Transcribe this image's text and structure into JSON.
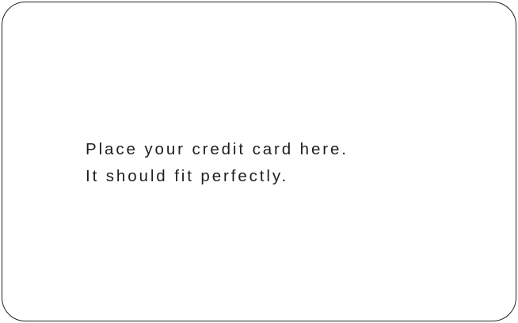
{
  "card": {
    "line1": "Place your credit card here.",
    "line2": "It should fit perfectly."
  },
  "colors": {
    "border": "#222222",
    "text": "#1e1e1e",
    "background": "#ffffff"
  }
}
